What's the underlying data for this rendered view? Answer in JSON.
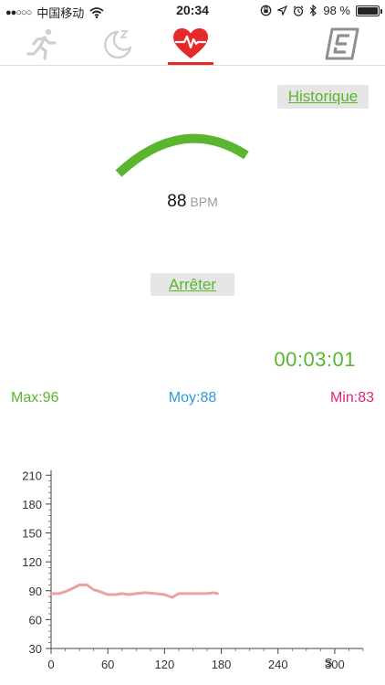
{
  "status_bar": {
    "signal_dots": "●●○○○",
    "carrier": "中国移动",
    "time": "20:34",
    "battery_text": "98 %",
    "battery_level": 0.98
  },
  "tabs": [
    {
      "name": "activity",
      "icon": "running-person-icon",
      "active": false
    },
    {
      "name": "sleep",
      "icon": "moon-sleep-icon",
      "active": false
    },
    {
      "name": "heart",
      "icon": "heart-pulse-icon",
      "active": true
    },
    {
      "name": "brand",
      "icon": "logo-e-icon",
      "active": false
    }
  ],
  "historique_label": "Historique",
  "heart_rate": {
    "value": "88",
    "unit": "BPM"
  },
  "stop_label": "Arrêter",
  "timer": "00:03:01",
  "stats": {
    "max": "Max:96",
    "avg": "Moy:88",
    "min": "Min:83"
  },
  "colors": {
    "green": "#5ab52f",
    "blue": "#2f9bd8",
    "pink": "#e2217a",
    "red": "#e62a2a",
    "line": "#e8a3a3"
  },
  "chart_data": {
    "type": "line",
    "x_unit": "S",
    "xlim": [
      0,
      330
    ],
    "ylim": [
      30,
      215
    ],
    "xticks": [
      0,
      60,
      120,
      180,
      240,
      300
    ],
    "yticks": [
      30,
      60,
      90,
      120,
      150,
      180,
      210
    ],
    "series": [
      {
        "x": [
          0,
          8,
          15,
          22,
          30,
          38,
          45,
          52,
          60,
          68,
          75,
          82,
          90,
          100,
          110,
          120,
          128,
          135,
          142,
          150,
          158,
          165,
          172,
          176
        ],
        "y": [
          87,
          87,
          89,
          92,
          96,
          96,
          91,
          89,
          86,
          86,
          87,
          86,
          87,
          88,
          87,
          86,
          83,
          87,
          87,
          87,
          87,
          87,
          88,
          87
        ]
      }
    ]
  }
}
